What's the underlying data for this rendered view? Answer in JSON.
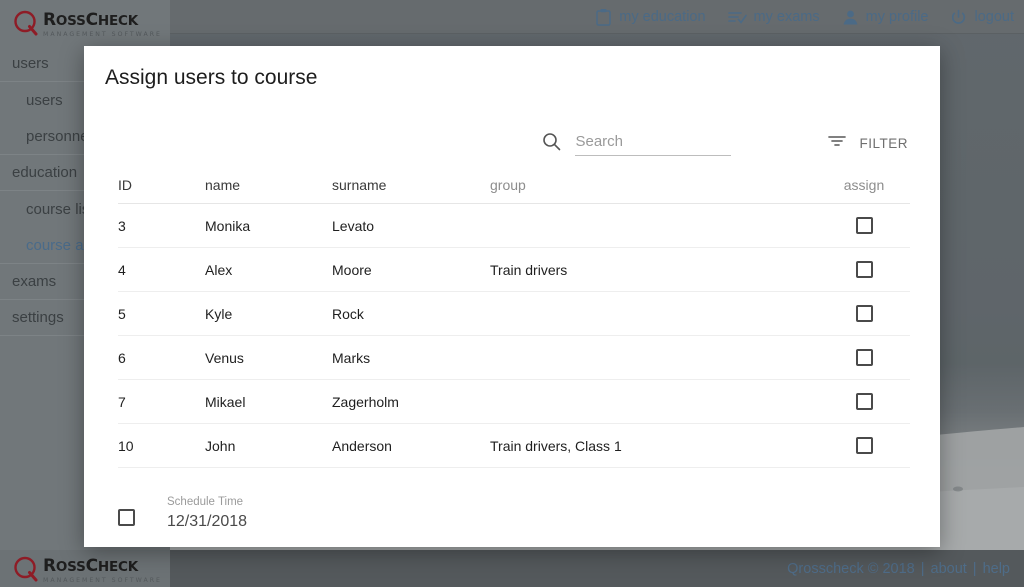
{
  "brand": {
    "logo_q": "Q",
    "logo_name_1": "R",
    "logo_name_rest": "OSS",
    "logo_name_2": "C",
    "logo_name_rest2": "HECK",
    "logo_tagline": "MANAGEMENT SOFTWARE",
    "accent_red": "#8e1c26",
    "link_blue": "#4e6c88"
  },
  "topnav": {
    "items": [
      {
        "label": "my education",
        "icon": "clipboard-icon"
      },
      {
        "label": "my exams",
        "icon": "list-check-icon"
      },
      {
        "label": "my profile",
        "icon": "person-icon"
      },
      {
        "label": "logout",
        "icon": "power-icon"
      }
    ]
  },
  "sidebar": {
    "items": [
      {
        "label": "users",
        "level": "top",
        "active": false
      },
      {
        "label": "users",
        "level": "sub",
        "active": false
      },
      {
        "label": "personnel",
        "level": "sub",
        "active": false
      },
      {
        "label": "education",
        "level": "top",
        "active": false
      },
      {
        "label": "course list",
        "level": "sub",
        "active": false
      },
      {
        "label": "course assign",
        "level": "sub",
        "active": true
      },
      {
        "label": "exams",
        "level": "top",
        "active": false
      },
      {
        "label": "settings",
        "level": "top",
        "active": false
      }
    ]
  },
  "dialog": {
    "title": "Assign users to course",
    "search": {
      "placeholder": "Search",
      "value": ""
    },
    "filter_label": "FILTER",
    "table": {
      "columns": [
        "ID",
        "name",
        "surname",
        "group",
        "assign"
      ],
      "rows": [
        {
          "id": "3",
          "name": "Monika",
          "surname": "Levato",
          "group": "",
          "assigned": false
        },
        {
          "id": "4",
          "name": "Alex",
          "surname": "Moore",
          "group": "Train drivers",
          "assigned": false
        },
        {
          "id": "5",
          "name": "Kyle",
          "surname": "Rock",
          "group": "",
          "assigned": false
        },
        {
          "id": "6",
          "name": "Venus",
          "surname": "Marks",
          "group": "",
          "assigned": false
        },
        {
          "id": "7",
          "name": "Mikael",
          "surname": "Zagerholm",
          "group": "",
          "assigned": false
        },
        {
          "id": "10",
          "name": "John",
          "surname": "Anderson",
          "group": "Train drivers, Class 1",
          "assigned": false
        }
      ]
    },
    "schedule": {
      "label": "Schedule Time",
      "value": "12/31/2018",
      "checked": false
    }
  },
  "footer": {
    "copyright": "Qrosscheck © 2018",
    "sep1": "|",
    "about": "about",
    "sep2": "|",
    "help": "help"
  }
}
